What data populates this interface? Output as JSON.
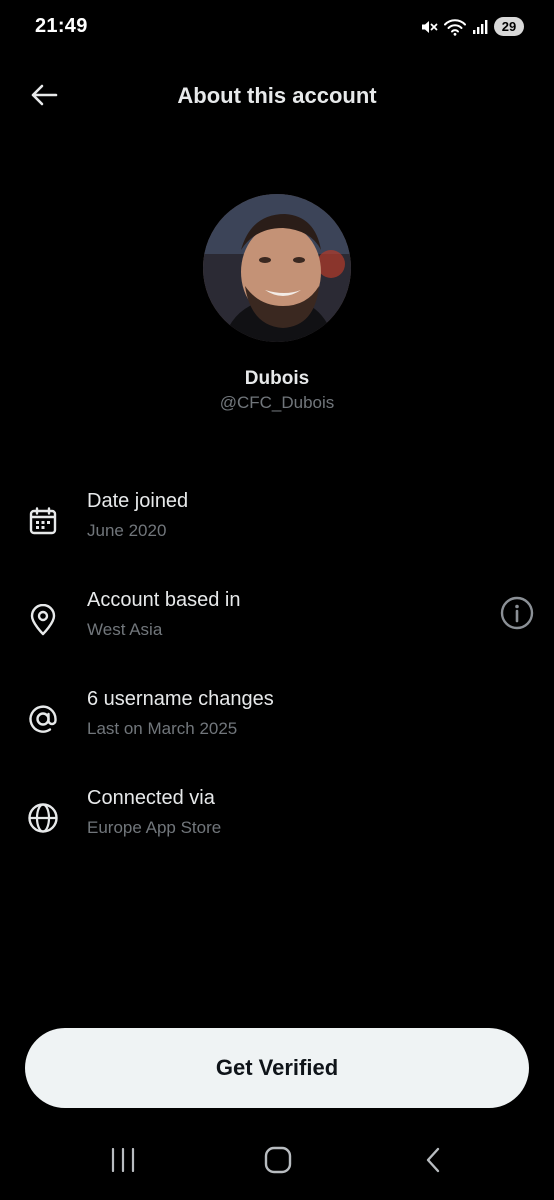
{
  "status_bar": {
    "time": "21:49",
    "battery": "29",
    "icons": [
      "mute-icon",
      "wifi-icon",
      "signal-icon",
      "battery-icon"
    ]
  },
  "header": {
    "title": "About this account",
    "back_icon": "arrow-left-icon"
  },
  "profile": {
    "display_name": "Dubois",
    "handle": "@CFC_Dubois"
  },
  "info_rows": [
    {
      "icon": "calendar-icon",
      "title": "Date joined",
      "subtitle": "June 2020"
    },
    {
      "icon": "location-pin-icon",
      "title": "Account based in",
      "subtitle": "West Asia",
      "action_icon": "info-circle-icon"
    },
    {
      "icon": "at-sign-icon",
      "title": "6 username changes",
      "subtitle": "Last on March 2025"
    },
    {
      "icon": "globe-icon",
      "title": "Connected via",
      "subtitle": "Europe App Store"
    }
  ],
  "verify_button": {
    "label": "Get Verified"
  },
  "nav_bar": {
    "icons": [
      "recent-apps-icon",
      "home-icon",
      "back-nav-icon"
    ]
  },
  "colors": {
    "background": "#000000",
    "primary_text": "#e7e9ea",
    "secondary_text": "#71767b",
    "button_bg": "#eff3f4",
    "button_text": "#0f1419"
  }
}
